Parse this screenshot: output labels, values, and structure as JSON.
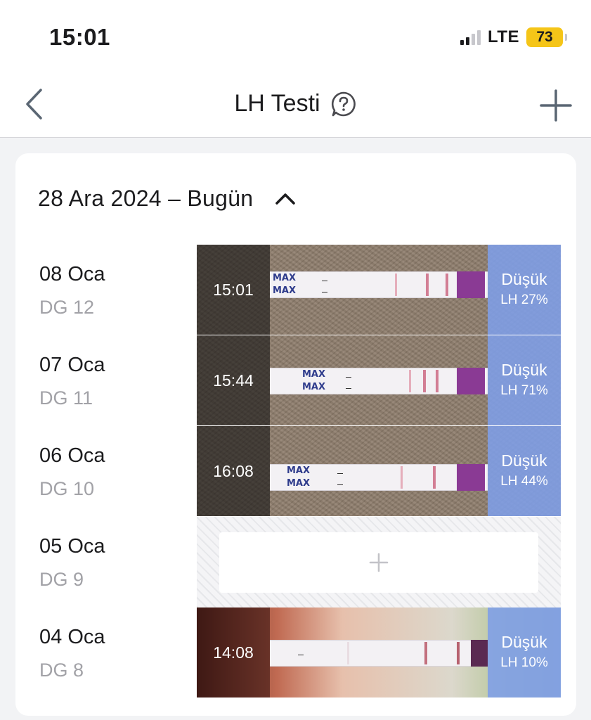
{
  "status_bar": {
    "time": "15:01",
    "network": "LTE",
    "battery": "73",
    "battery_color": "#f5c518"
  },
  "nav": {
    "title": "LH Testi",
    "back_icon": "chevron-left-icon",
    "help_icon": "question-bubble-icon",
    "add_icon": "plus-icon"
  },
  "range": {
    "label": "28 Ara 2024 – Bugün",
    "toggle_icon": "chevron-up-icon"
  },
  "entries": [
    {
      "date": "08 Oca",
      "cycle_day": "DG 12",
      "time": "15:01",
      "result": "Düşük",
      "lh": "LH 27%"
    },
    {
      "date": "07 Oca",
      "cycle_day": "DG 11",
      "time": "15:44",
      "result": "Düşük",
      "lh": "LH 71%"
    },
    {
      "date": "06 Oca",
      "cycle_day": "DG 10",
      "time": "16:08",
      "result": "Düşük",
      "lh": "LH 44%"
    },
    {
      "date": "05 Oca",
      "cycle_day": "DG 9",
      "empty": true,
      "add_icon": "plus-icon"
    },
    {
      "date": "04 Oca",
      "cycle_day": "DG 8",
      "time": "14:08",
      "result": "Düşük",
      "lh": "LH 10%"
    }
  ],
  "strip_text": "MAX",
  "colors": {
    "result_overlay": "#7e9ee8",
    "time_overlay": "#141414",
    "secondary_text": "#a2a2a7"
  }
}
